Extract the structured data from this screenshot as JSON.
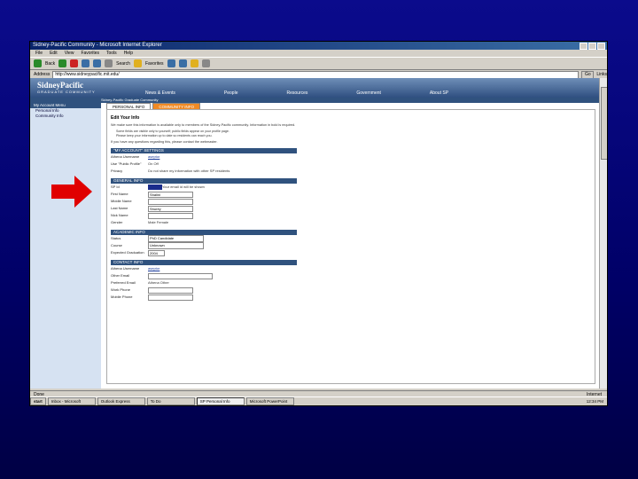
{
  "window": {
    "title": "Sidney-Pacific Community - Microsoft Internet Explorer"
  },
  "menubar": [
    "File",
    "Edit",
    "View",
    "Favorites",
    "Tools",
    "Help"
  ],
  "toolbar": {
    "back": "Back",
    "search": "Search",
    "favorites": "Favorites"
  },
  "address": {
    "label": "Address",
    "value": "http://www.sidneypacific.mit.edu/",
    "go": "Go",
    "links": "Links"
  },
  "site": {
    "logo": "SidneyPacific",
    "tagline": "GRADUATE COMMUNITY",
    "nav": [
      "News & Events",
      "People",
      "Resources",
      "Government",
      "About SP"
    ],
    "subnav": "Sidney-Pacific Graduate Community"
  },
  "sidebar": {
    "heading": "My Account Menu",
    "links": [
      "Personal Info",
      "Community Info"
    ]
  },
  "tabs": [
    "PERSONAL INFO",
    "COMMUNITY INFO"
  ],
  "page": {
    "title": "Edit Your Info",
    "intro": "We make sure this information is available only to members of the Sidney-Pacific community. Information in bold is required.",
    "bullets": [
      "Some fields are visible only to yourself; public fields appear on your profile page.",
      "Please keep your information up to date so residents can reach you."
    ],
    "contact": "If you have any questions regarding this, please contact the webmaster."
  },
  "sections": {
    "account": {
      "heading": "\"MY ACCOUNT\" SETTINGS",
      "rows": [
        {
          "label": "Athena Username",
          "value": "aseptor"
        },
        {
          "label": "Use \"Public Profile\"",
          "value": "On   Off"
        },
        {
          "label": "Privacy",
          "value": "Do not share my information with other SP residents"
        }
      ]
    },
    "general": {
      "heading": "GENERAL INFO",
      "rows": [
        {
          "label": "SP Id",
          "value": "Your email id will be shown"
        },
        {
          "label": "First Name",
          "value": "Shalini"
        },
        {
          "label": "Middle Name",
          "value": ""
        },
        {
          "label": "Last Name",
          "value": "Shurey"
        },
        {
          "label": "Nick Name",
          "value": ""
        },
        {
          "label": "Gender",
          "value": "Male   Female"
        }
      ]
    },
    "academic": {
      "heading": "ACADEMIC INFO",
      "rows": [
        {
          "label": "Status",
          "value": "PhD Candidate"
        },
        {
          "label": "Course",
          "value": "Unknown"
        },
        {
          "label": "Expected Graduation",
          "value": "2004"
        }
      ]
    },
    "contactinfo": {
      "heading": "CONTACT INFO",
      "rows": [
        {
          "label": "Athena Username",
          "value": "aseptor"
        },
        {
          "label": "Other Email",
          "value": ""
        },
        {
          "label": "Preferred Email",
          "value": "Athena   Other"
        },
        {
          "label": "Work Phone",
          "value": ""
        },
        {
          "label": "Mobile Phone",
          "value": ""
        }
      ]
    }
  },
  "statusbar": {
    "left": "Done",
    "right": "Internet"
  },
  "taskbar": {
    "start": "start",
    "tasks": [
      "Inbox - Microsoft",
      "Outlook Express",
      "To Do",
      "SP Personal Info",
      "Microsoft PowerPoint"
    ],
    "clock": "12:34 PM"
  },
  "colors": {
    "slide_bg": "#00006b",
    "arrow": "#e00000",
    "header_blue": "#30527e"
  }
}
